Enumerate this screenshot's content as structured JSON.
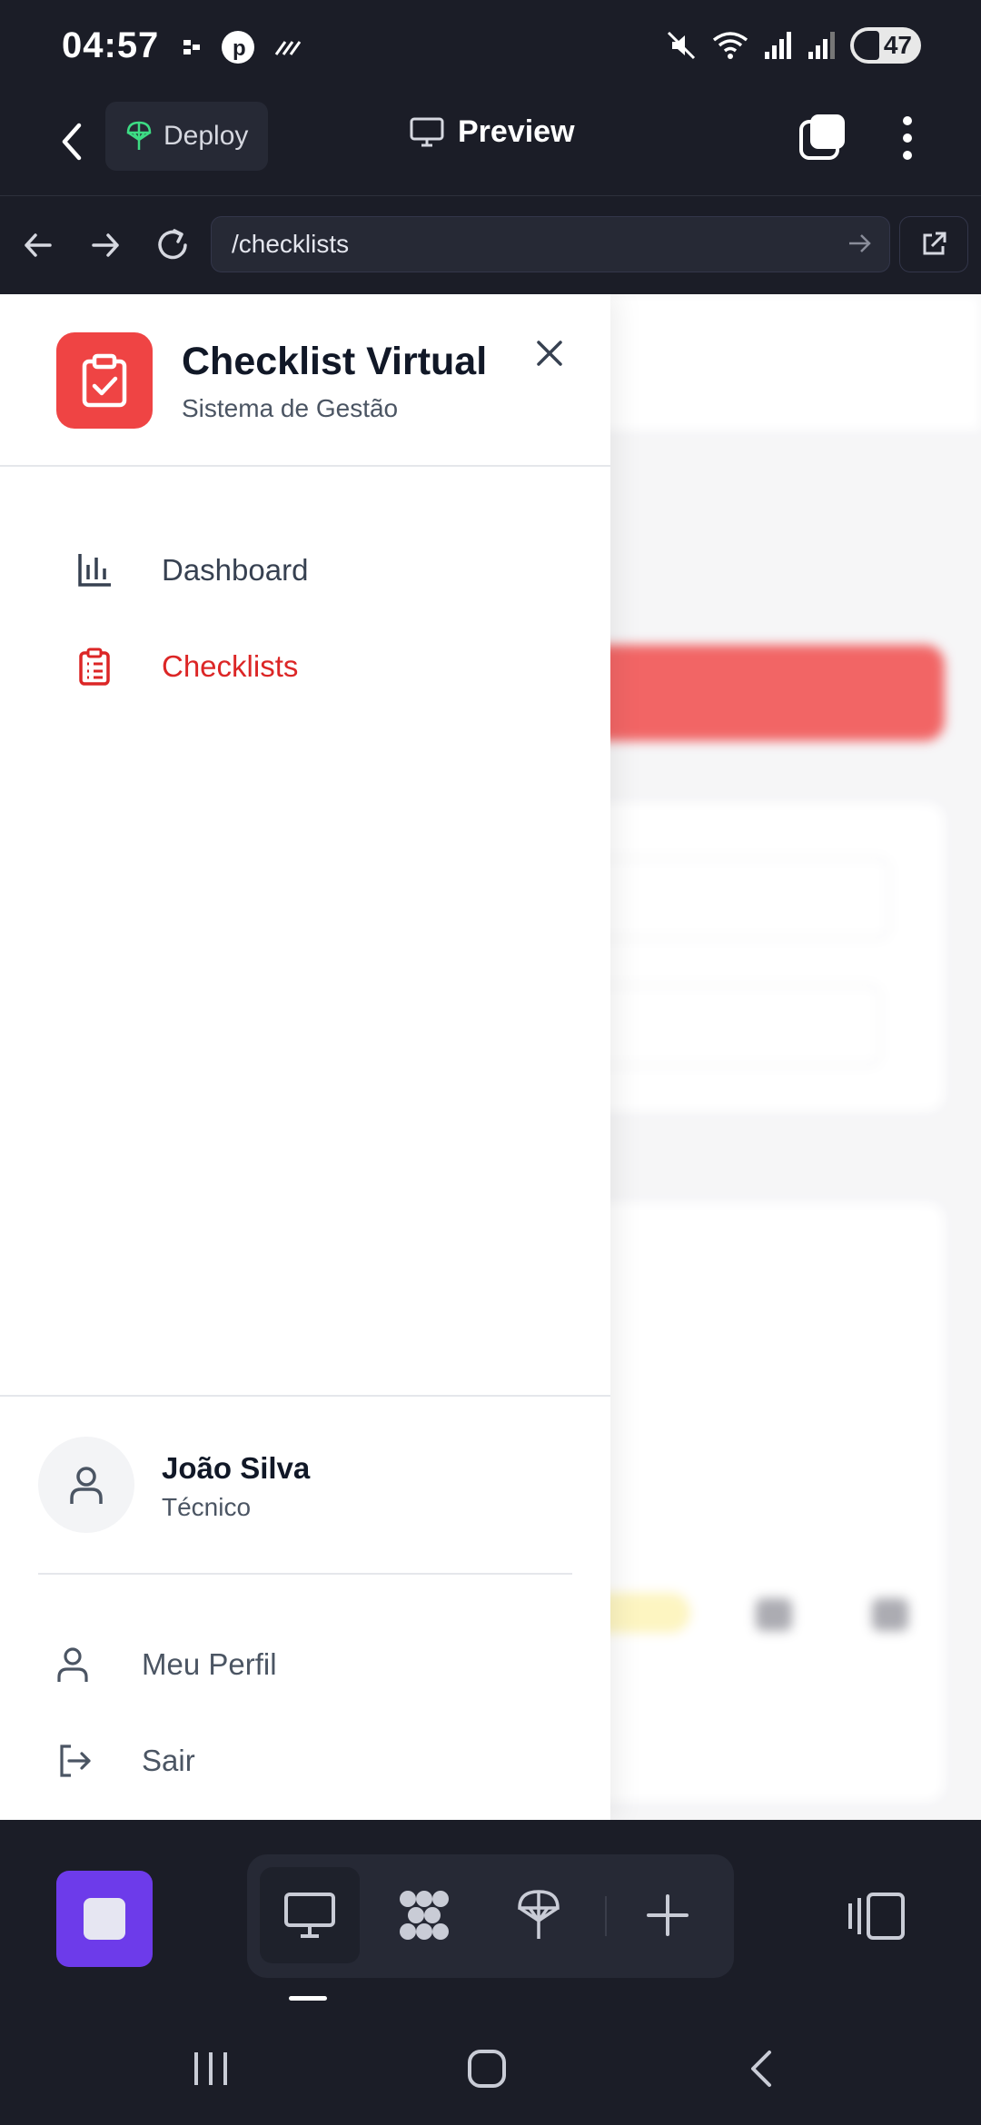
{
  "status_bar": {
    "time": "04:57",
    "battery": "47",
    "icons": [
      "notification-dots-icon",
      "p-badge-icon",
      "stripes-icon",
      "mute-icon",
      "wifi-icon",
      "signal-icon",
      "signal-icon-2"
    ]
  },
  "app_header": {
    "deploy_label": "Deploy",
    "preview_label": "Preview"
  },
  "url_bar": {
    "url": "/checklists"
  },
  "drawer": {
    "app_name": "Checklist Virtual",
    "app_subtitle": "Sistema de Gestão",
    "nav": [
      {
        "label": "Dashboard",
        "icon": "bar-chart-icon",
        "active": false
      },
      {
        "label": "Checklists",
        "icon": "clipboard-list-icon",
        "active": true
      }
    ],
    "user": {
      "name": "João Silva",
      "role": "Técnico"
    },
    "footer_items": [
      {
        "label": "Meu Perfil",
        "icon": "user-icon"
      },
      {
        "label": "Sair",
        "icon": "logout-icon"
      }
    ]
  },
  "colors": {
    "accent_red": "#ef4444",
    "active_text": "#dc2626",
    "dark_bg": "#1b1d27",
    "stop_button": "#6d3bea",
    "deploy_icon": "#3ddc84"
  }
}
